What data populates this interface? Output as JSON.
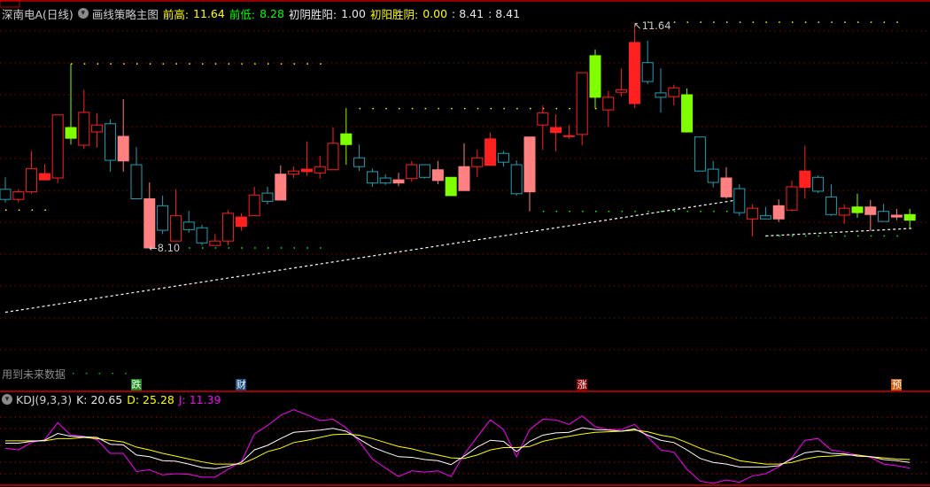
{
  "header": {
    "stock": "深南电A(日线)",
    "indicator": "画线策略主图",
    "prev_high_label": "前高:",
    "prev_high_value": "11.64",
    "prev_low_label": "前低:",
    "prev_low_value": "8.28",
    "yin_win_yang_label": "初阴胜阳:",
    "yin_win_yang_value": "1.00",
    "yang_win_yin_label": "初阳胜阴:",
    "yang_win_yin_value": "0.00",
    "extra1": ": 8.41",
    "extra2": ": 8.41"
  },
  "annotations": {
    "high_label": "11.64",
    "low_label": "8.10",
    "future_data_label": "用到未来数据"
  },
  "badges": [
    {
      "text": "跌",
      "color": "#1a8a1a",
      "candle": 10
    },
    {
      "text": "财",
      "color": "#1a4a80",
      "candle": 18
    },
    {
      "text": "涨",
      "color": "#8b0000",
      "candle": 44
    },
    {
      "text": "预",
      "color": "#d05a10",
      "candle": 68
    }
  ],
  "kdj_header": {
    "name": "KDJ(9,3,3)",
    "k_label": "K: 20.65",
    "d_label": "D: 25.28",
    "j_label": "J: 11.39"
  },
  "colors": {
    "up": "#ff2020",
    "down": "#20a0b4",
    "pink": "#ff8080",
    "green": "#80ff00",
    "grid": "#8b0000",
    "k": "#ffffff",
    "d": "#ffff00",
    "j": "#ff00ff"
  },
  "chart_data": {
    "type": "candlestick",
    "price_range": [
      8.1,
      11.64
    ],
    "candle_columns": [
      "style",
      "high",
      "low",
      "body_high",
      "body_low"
    ],
    "candles": [
      [
        "c",
        9.22,
        8.82,
        9.03,
        8.87
      ],
      [
        "r",
        9.03,
        8.82,
        8.99,
        8.87
      ],
      [
        "r",
        9.64,
        8.96,
        9.36,
        8.99
      ],
      [
        "R",
        9.43,
        9.17,
        9.28,
        9.18
      ],
      [
        "r",
        10.21,
        9.13,
        10.21,
        9.21
      ],
      [
        "g",
        11.02,
        9.74,
        10.01,
        9.84
      ],
      [
        "r",
        10.61,
        9.67,
        10.25,
        9.73
      ],
      [
        "r",
        10.24,
        9.69,
        10.05,
        9.94
      ],
      [
        "c",
        10.14,
        9.31,
        10.07,
        9.49
      ],
      [
        "p",
        10.46,
        9.31,
        9.87,
        9.48
      ],
      [
        "c",
        9.7,
        8.88,
        9.42,
        8.88
      ],
      [
        "p",
        9.14,
        8.1,
        8.88,
        8.1
      ],
      [
        "c",
        8.93,
        8.32,
        8.77,
        8.38
      ],
      [
        "r",
        9.03,
        8.21,
        8.61,
        8.21
      ],
      [
        "c",
        8.69,
        8.34,
        8.51,
        8.39
      ],
      [
        "c",
        8.47,
        8.14,
        8.42,
        8.18
      ],
      [
        "r",
        8.32,
        8.14,
        8.21,
        8.14
      ],
      [
        "r",
        8.7,
        8.14,
        8.65,
        8.21
      ],
      [
        "R",
        8.65,
        8.37,
        8.59,
        8.44
      ],
      [
        "r",
        9.07,
        8.61,
        8.94,
        8.61
      ],
      [
        "c",
        9.07,
        8.79,
        8.97,
        8.84
      ],
      [
        "p",
        9.41,
        8.86,
        9.27,
        8.86
      ],
      [
        "r",
        9.39,
        9.21,
        9.32,
        9.27
      ],
      [
        "R",
        9.79,
        9.24,
        9.35,
        9.31
      ],
      [
        "r",
        9.56,
        9.2,
        9.39,
        9.29
      ],
      [
        "r",
        10.01,
        9.34,
        9.76,
        9.34
      ],
      [
        "g",
        10.32,
        9.42,
        9.91,
        9.74
      ],
      [
        "c",
        9.74,
        9.32,
        9.53,
        9.39
      ],
      [
        "c",
        9.36,
        9.07,
        9.31,
        9.13
      ],
      [
        "c",
        9.27,
        9.1,
        9.21,
        9.13
      ],
      [
        "p",
        9.29,
        9.08,
        9.18,
        9.13
      ],
      [
        "r",
        9.48,
        9.15,
        9.42,
        9.2
      ],
      [
        "c",
        9.42,
        9.2,
        9.42,
        9.22
      ],
      [
        "p",
        9.48,
        9.11,
        9.34,
        9.17
      ],
      [
        "g",
        9.22,
        8.93,
        9.22,
        8.93
      ],
      [
        "p",
        9.76,
        9.01,
        9.39,
        9.01
      ],
      [
        "r",
        9.66,
        9.22,
        9.53,
        9.39
      ],
      [
        "R",
        9.93,
        9.41,
        9.83,
        9.41
      ],
      [
        "c",
        9.64,
        9.39,
        9.6,
        9.46
      ],
      [
        "c",
        9.49,
        8.93,
        9.42,
        8.96
      ],
      [
        "p",
        9.86,
        8.68,
        9.86,
        8.99
      ],
      [
        "r",
        10.36,
        9.66,
        10.24,
        10.05
      ],
      [
        "R",
        10.22,
        9.63,
        10.01,
        9.93
      ],
      [
        "r",
        10.05,
        9.83,
        9.88,
        9.88
      ],
      [
        "r",
        10.88,
        9.73,
        10.88,
        9.9
      ],
      [
        "g",
        11.25,
        10.31,
        11.15,
        10.49
      ],
      [
        "r",
        10.59,
        10.02,
        10.49,
        10.29
      ],
      [
        "r",
        10.95,
        10.5,
        10.61,
        10.57
      ],
      [
        "R",
        11.64,
        10.32,
        11.36,
        10.39
      ],
      [
        "c",
        11.39,
        10.7,
        11.04,
        10.74
      ],
      [
        "c",
        10.95,
        10.25,
        10.56,
        10.49
      ],
      [
        "r",
        10.69,
        10.36,
        10.64,
        10.5
      ],
      [
        "g",
        10.63,
        9.93,
        10.53,
        9.94
      ],
      [
        "c",
        9.86,
        9.32,
        9.86,
        9.32
      ],
      [
        "c",
        9.48,
        9.06,
        9.35,
        9.14
      ],
      [
        "p",
        9.38,
        8.88,
        9.21,
        8.91
      ],
      [
        "c",
        9.11,
        8.61,
        9.04,
        8.66
      ],
      [
        "r",
        8.79,
        8.28,
        8.73,
        8.56
      ],
      [
        "c",
        8.75,
        8.56,
        8.61,
        8.56
      ],
      [
        "p",
        8.87,
        8.51,
        8.77,
        8.56
      ],
      [
        "r",
        9.17,
        8.68,
        9.07,
        8.7
      ],
      [
        "R",
        9.72,
        8.88,
        9.32,
        9.06
      ],
      [
        "c",
        9.25,
        8.97,
        9.22,
        9.0
      ],
      [
        "c",
        9.11,
        8.61,
        8.91,
        8.63
      ],
      [
        "r",
        8.79,
        8.48,
        8.73,
        8.62
      ],
      [
        "g",
        8.96,
        8.58,
        8.75,
        8.66
      ],
      [
        "p",
        8.86,
        8.37,
        8.75,
        8.63
      ],
      [
        "c",
        8.8,
        8.52,
        8.68,
        8.52
      ],
      [
        "p",
        8.72,
        8.54,
        8.62,
        8.59
      ],
      [
        "g",
        8.72,
        8.42,
        8.63,
        8.54
      ]
    ],
    "level_lines": [
      {
        "price": 8.7,
        "from": 0,
        "to": 4,
        "color": "#ffff00"
      },
      {
        "price": 11.02,
        "from": 5,
        "to": 25,
        "color": "#ffff00"
      },
      {
        "price": 10.31,
        "from": 27,
        "to": 46,
        "color": "#ffff00"
      },
      {
        "price": 11.68,
        "from": 49,
        "to": 69,
        "color": "#ffff00"
      },
      {
        "price": 8.1,
        "from": 14,
        "to": 25,
        "color": "#00ff00"
      },
      {
        "price": 8.68,
        "from": 41,
        "to": 57,
        "color": "#00ff00"
      },
      {
        "price": 8.29,
        "from": 58,
        "to": 69,
        "color": "#00ff00"
      }
    ],
    "trend_lines": [
      {
        "from": 0,
        "from_price": 7.08,
        "to": 56,
        "to_price": 8.87
      },
      {
        "from": 58,
        "from_price": 8.29,
        "to": 69,
        "to_price": 8.41
      }
    ],
    "kdj": {
      "range": [
        0,
        100
      ],
      "K": [
        54,
        54,
        57,
        59,
        71,
        66,
        65,
        64,
        52,
        51,
        33,
        30,
        23,
        22,
        17,
        11,
        9,
        13,
        20,
        42,
        50,
        62,
        73,
        75,
        77,
        80,
        75,
        61,
        47,
        38,
        30,
        29,
        25,
        23,
        16,
        31,
        47,
        59,
        57,
        39,
        57,
        68,
        72,
        73,
        81,
        78,
        77,
        75,
        79,
        68,
        59,
        55,
        42,
        27,
        20,
        17,
        12,
        12,
        12,
        14,
        26,
        37,
        40,
        36,
        35,
        31,
        30,
        25,
        23,
        20
      ],
      "D": [
        58,
        58,
        58,
        58,
        62,
        62,
        64,
        62,
        59,
        56,
        47,
        42,
        36,
        31,
        26,
        21,
        17,
        17,
        17,
        27,
        39,
        45,
        55,
        59,
        64,
        69,
        70,
        68,
        62,
        55,
        48,
        44,
        38,
        33,
        28,
        27,
        33,
        42,
        46,
        46,
        48,
        57,
        62,
        66,
        70,
        73,
        74,
        75,
        77,
        74,
        68,
        64,
        55,
        45,
        37,
        31,
        23,
        20,
        17,
        17,
        20,
        26,
        30,
        31,
        33,
        33,
        30,
        28,
        26,
        25
      ],
      "J": [
        45,
        42,
        55,
        60,
        90,
        68,
        66,
        60,
        36,
        36,
        4,
        7,
        -2,
        0,
        -1,
        -6,
        -6,
        8,
        21,
        70,
        85,
        103,
        113,
        104,
        94,
        96,
        81,
        57,
        26,
        10,
        -5,
        5,
        3,
        5,
        -5,
        34,
        65,
        95,
        78,
        30,
        78,
        96,
        95,
        87,
        102,
        83,
        78,
        78,
        87,
        65,
        42,
        38,
        8,
        -13,
        -17,
        -11,
        -15,
        -4,
        0,
        12,
        28,
        59,
        62,
        42,
        38,
        33,
        29,
        17,
        14,
        10
      ]
    }
  }
}
